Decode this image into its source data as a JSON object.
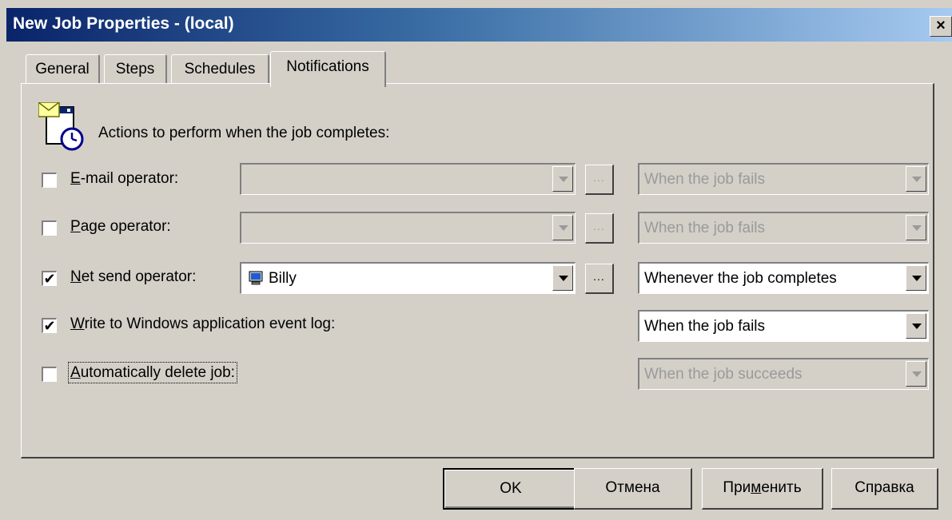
{
  "window": {
    "title": "New Job Properties - (local)",
    "close_label": "×"
  },
  "tabs": [
    {
      "label": "General"
    },
    {
      "label": "Steps"
    },
    {
      "label": "Schedules"
    },
    {
      "label": "Notifications",
      "active": true
    }
  ],
  "section": {
    "icon": "mail-clock-icon",
    "label": "Actions to perform when the job completes:"
  },
  "rows": {
    "email": {
      "checked": false,
      "label_mnemonic": "E",
      "label_rest": "-mail operator:",
      "operator": "",
      "condition": "When the job fails",
      "dots": "..."
    },
    "page": {
      "checked": false,
      "label_mnemonic": "P",
      "label_rest": "age operator:",
      "operator": "",
      "condition": "When the job fails",
      "dots": "..."
    },
    "netsend": {
      "checked": true,
      "check_mark": "✔",
      "label_mnemonic": "N",
      "label_rest": "et send operator:",
      "operator": "Billy",
      "operator_icon": "computer-icon",
      "condition": "Whenever the job completes",
      "dots": "..."
    },
    "eventlog": {
      "checked": true,
      "check_mark": "✔",
      "label_mnemonic": "W",
      "label_rest": "rite to Windows application event log:",
      "condition": "When the job fails"
    },
    "autodelete": {
      "checked": false,
      "label_mnemonic": "A",
      "label_rest": "utomatically delete job:",
      "condition": "When the job succeeds"
    }
  },
  "buttons": {
    "ok": "OK",
    "cancel": "Отмена",
    "apply_pre": "При",
    "apply_mnemonic": "м",
    "apply_post": "енить",
    "help": "Справка"
  },
  "colors": {
    "title_bar_start": "#0a246a",
    "title_bar_end": "#a6caf0",
    "face": "#d4d0c8",
    "disabled_text": "#9a9a9a"
  }
}
